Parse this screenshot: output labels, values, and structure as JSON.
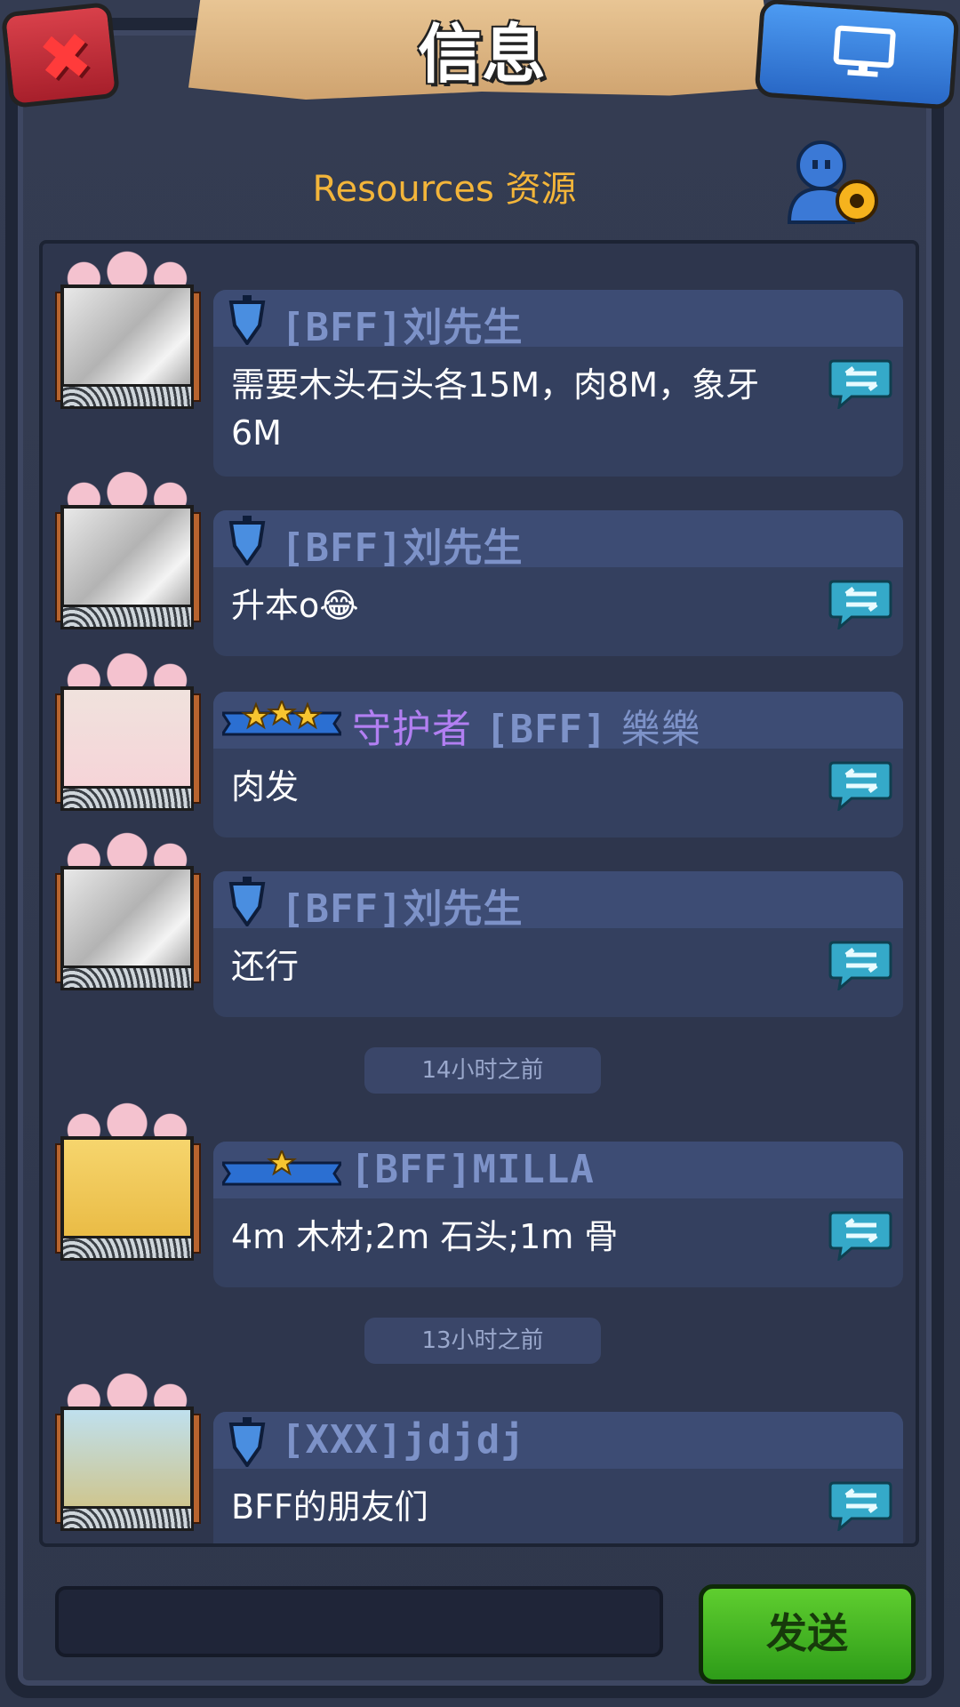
{
  "header": {
    "title": "信息",
    "close_icon": "close-icon",
    "screen_icon": "monitor-icon"
  },
  "channel": {
    "label": "Resources 资源",
    "settings_icon": "user-settings-icon"
  },
  "messages": [
    {
      "sender": "[BFF]刘先生",
      "rank_icon": "shield-icon",
      "text": "需要木头石头各15M，肉8M，象牙6M",
      "avatar": "bw-photo"
    },
    {
      "sender": "[BFF]刘先生",
      "rank_icon": "shield-icon",
      "text": "升本o😂",
      "avatar": "bw-photo"
    },
    {
      "sender_title": "守护者",
      "sender_tag": "[BFF]",
      "sender": "樂樂",
      "rank_icon": "three-star-banner-icon",
      "text": "肉发",
      "avatar": "girl-photo"
    },
    {
      "sender": "[BFF]刘先生",
      "rank_icon": "shield-icon",
      "text": "还行",
      "avatar": "bw-photo"
    },
    {
      "sender": "[BFF]MILLA",
      "rank_icon": "one-star-banner-icon",
      "text": "4m 木材;2m 石头;1m 骨",
      "avatar": "blonde-hero"
    },
    {
      "sender": "[XXX]jdjdj",
      "rank_icon": "shield-icon",
      "text": "BFF的朋友们",
      "avatar": "beast-hero"
    }
  ],
  "timestamps": [
    "14小时之前",
    "13小时之前"
  ],
  "composer": {
    "input_value": "",
    "send_label": "发送"
  },
  "colors": {
    "background": "#2b3550",
    "bubble": "#34405f",
    "name_blue": "#7d92c8",
    "name_purple": "#b27ff2",
    "channel_gold": "#f3b53a",
    "send_green": "#3fb522"
  }
}
